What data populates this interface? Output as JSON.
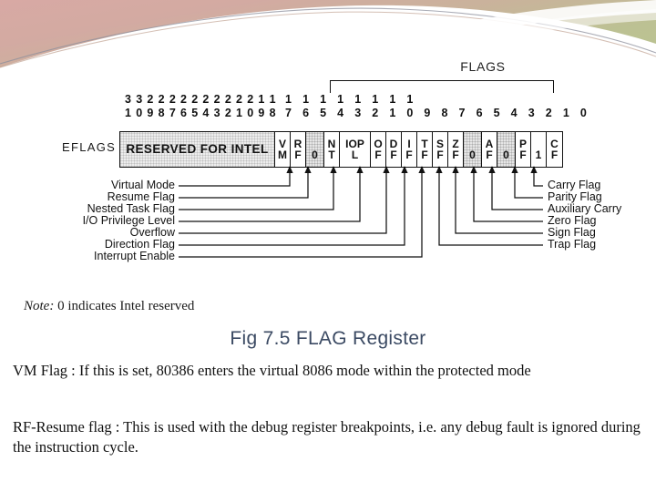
{
  "slide": {
    "banner_colors": {
      "top": "#d8a9a4",
      "mid": "#c9b39b",
      "bottom": "#b9c48f",
      "swoosh_a": "#8c8f9c",
      "swoosh_b": "#b08a76"
    },
    "caption": "Fig 7.5 FLAG Register",
    "caption_color": "#3b4a63"
  },
  "figure": {
    "flags_bracket_label": "FLAGS",
    "eflags_label": "EFLAGS",
    "note_prefix": "Note:",
    "note_text": " 0 indicates Intel reserved",
    "bit_numbers": [
      {
        "top": "3",
        "bottom": "1"
      },
      {
        "top": "3",
        "bottom": "0"
      },
      {
        "top": "2",
        "bottom": "9"
      },
      {
        "top": "2",
        "bottom": "8"
      },
      {
        "top": "2",
        "bottom": "7"
      },
      {
        "top": "2",
        "bottom": "6"
      },
      {
        "top": "2",
        "bottom": "5"
      },
      {
        "top": "2",
        "bottom": "4"
      },
      {
        "top": "2",
        "bottom": "3"
      },
      {
        "top": "2",
        "bottom": "2"
      },
      {
        "top": "2",
        "bottom": "1"
      },
      {
        "top": "2",
        "bottom": "0"
      },
      {
        "top": "1",
        "bottom": "9"
      },
      {
        "top": "1",
        "bottom": "8"
      },
      {
        "top": "1",
        "bottom": "7"
      },
      {
        "top": "1",
        "bottom": "6"
      },
      {
        "top": "1",
        "bottom": "5"
      },
      {
        "top": "1",
        "bottom": "4"
      },
      {
        "top": "1",
        "bottom": "3"
      },
      {
        "top": "1",
        "bottom": "2"
      },
      {
        "top": "1",
        "bottom": "1"
      },
      {
        "top": "1",
        "bottom": "0"
      },
      {
        "top": "",
        "bottom": "9"
      },
      {
        "top": "",
        "bottom": "8"
      },
      {
        "top": "",
        "bottom": "7"
      },
      {
        "top": "",
        "bottom": "6"
      },
      {
        "top": "",
        "bottom": "5"
      },
      {
        "top": "",
        "bottom": "4"
      },
      {
        "top": "",
        "bottom": "3"
      },
      {
        "top": "",
        "bottom": "2"
      },
      {
        "top": "",
        "bottom": "1"
      },
      {
        "top": "",
        "bottom": "0"
      }
    ],
    "register_cells": [
      {
        "id": "reserved",
        "line1": "RESERVED FOR INTEL",
        "line2": "",
        "shaded": true,
        "wide": true
      },
      {
        "id": "vm",
        "line1": "V",
        "line2": "M",
        "shaded": false
      },
      {
        "id": "rf",
        "line1": "R",
        "line2": "F",
        "shaded": false
      },
      {
        "id": "res-16",
        "line1": "",
        "line2": "0",
        "shaded": true
      },
      {
        "id": "nt",
        "line1": "N",
        "line2": "T",
        "shaded": false
      },
      {
        "id": "iopl",
        "line1": "IOP",
        "line2": "L",
        "shaded": false
      },
      {
        "id": "of",
        "line1": "O",
        "line2": "F",
        "shaded": false
      },
      {
        "id": "df",
        "line1": "D",
        "line2": "F",
        "shaded": false
      },
      {
        "id": "if",
        "line1": "I",
        "line2": "F",
        "shaded": false
      },
      {
        "id": "tf",
        "line1": "T",
        "line2": "F",
        "shaded": false
      },
      {
        "id": "sf",
        "line1": "S",
        "line2": "F",
        "shaded": false
      },
      {
        "id": "zf",
        "line1": "Z",
        "line2": "F",
        "shaded": false
      },
      {
        "id": "res-5",
        "line1": "",
        "line2": "0",
        "shaded": true
      },
      {
        "id": "af",
        "line1": "A",
        "line2": "F",
        "shaded": false
      },
      {
        "id": "res-3",
        "line1": "",
        "line2": "0",
        "shaded": true
      },
      {
        "id": "pf",
        "line1": "P",
        "line2": "F",
        "shaded": false
      },
      {
        "id": "res-1",
        "line1": "",
        "line2": "1",
        "shaded": false
      },
      {
        "id": "cf",
        "line1": "C",
        "line2": "F",
        "shaded": false
      }
    ],
    "left_labels": [
      "Virtual Mode",
      "Resume Flag",
      "Nested Task Flag",
      "I/O Privilege Level",
      "Overflow",
      "Direction Flag",
      "Interrupt Enable"
    ],
    "right_labels": [
      "Carry Flag",
      "Parity Flag",
      "Auxiliary Carry",
      "Zero Flag",
      "Sign Flag",
      "Trap Flag"
    ]
  },
  "body": {
    "paragraph1": "VM Flag : If this is set, 80386 enters the virtual 8086 mode within the protected mode",
    "paragraph2": "RF-Resume flag : This is used with the debug register breakpoints, i.e. any debug fault is ignored during the instruction cycle."
  }
}
